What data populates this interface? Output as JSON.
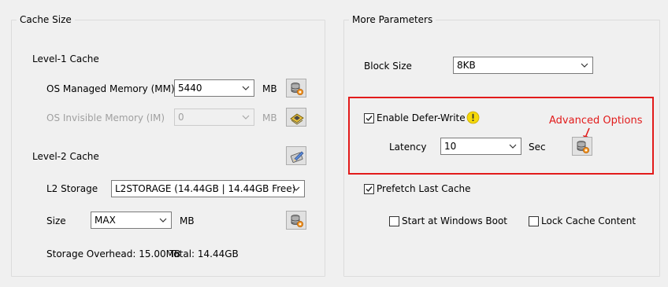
{
  "cache_size": {
    "title": "Cache Size",
    "level1": {
      "title": "Level-1 Cache",
      "os_managed": {
        "label": "OS Managed Memory (MM)",
        "value": "5440",
        "unit": "MB"
      },
      "os_invisible": {
        "label": "OS Invisible Memory (IM)",
        "value": "0",
        "unit": "MB"
      }
    },
    "level2": {
      "title": "Level-2 Cache",
      "storage": {
        "label": "L2 Storage",
        "value": "L2STORAGE (14.44GB | 14.44GB Free)"
      },
      "size": {
        "label": "Size",
        "value": "MAX",
        "unit": "MB"
      },
      "overhead": "Storage Overhead: 15.00MB",
      "total": "Total: 14.44GB"
    }
  },
  "more_params": {
    "title": "More Parameters",
    "block_size": {
      "label": "Block Size",
      "value": "8KB"
    },
    "defer_write": {
      "label": "Enable Defer-Write",
      "checked": true
    },
    "latency": {
      "label": "Latency",
      "value": "10",
      "unit": "Sec"
    },
    "advanced_annotation": "Advanced Options",
    "prefetch": {
      "label": "Prefetch Last Cache",
      "checked": true
    },
    "start_at_boot": {
      "label": "Start at Windows Boot",
      "checked": false
    },
    "lock_cache": {
      "label": "Lock Cache Content",
      "checked": false
    }
  },
  "colors": {
    "annotation_red": "#e21b1b",
    "warning_yellow": "#f5d90a"
  }
}
